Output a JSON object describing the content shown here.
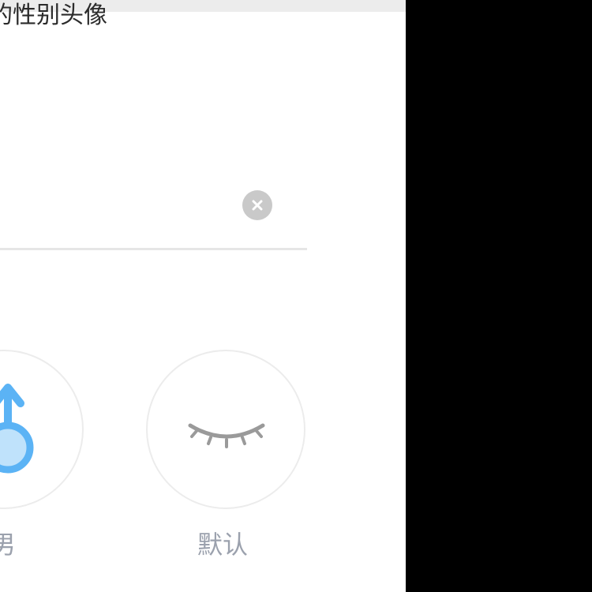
{
  "header": {
    "partial_title": "的性别头像"
  },
  "input": {
    "clear_icon": "clear-icon"
  },
  "gender_options": [
    {
      "label": "男",
      "icon": "male-symbol-icon",
      "color": "#5bb3f5"
    },
    {
      "label": "默认",
      "icon": "closed-eye-icon",
      "color": "#9a9a9a"
    }
  ],
  "colors": {
    "background_right": "#000000",
    "panel": "#ffffff",
    "label": "#9ba1ad",
    "male_accent": "#5bb3f5"
  }
}
